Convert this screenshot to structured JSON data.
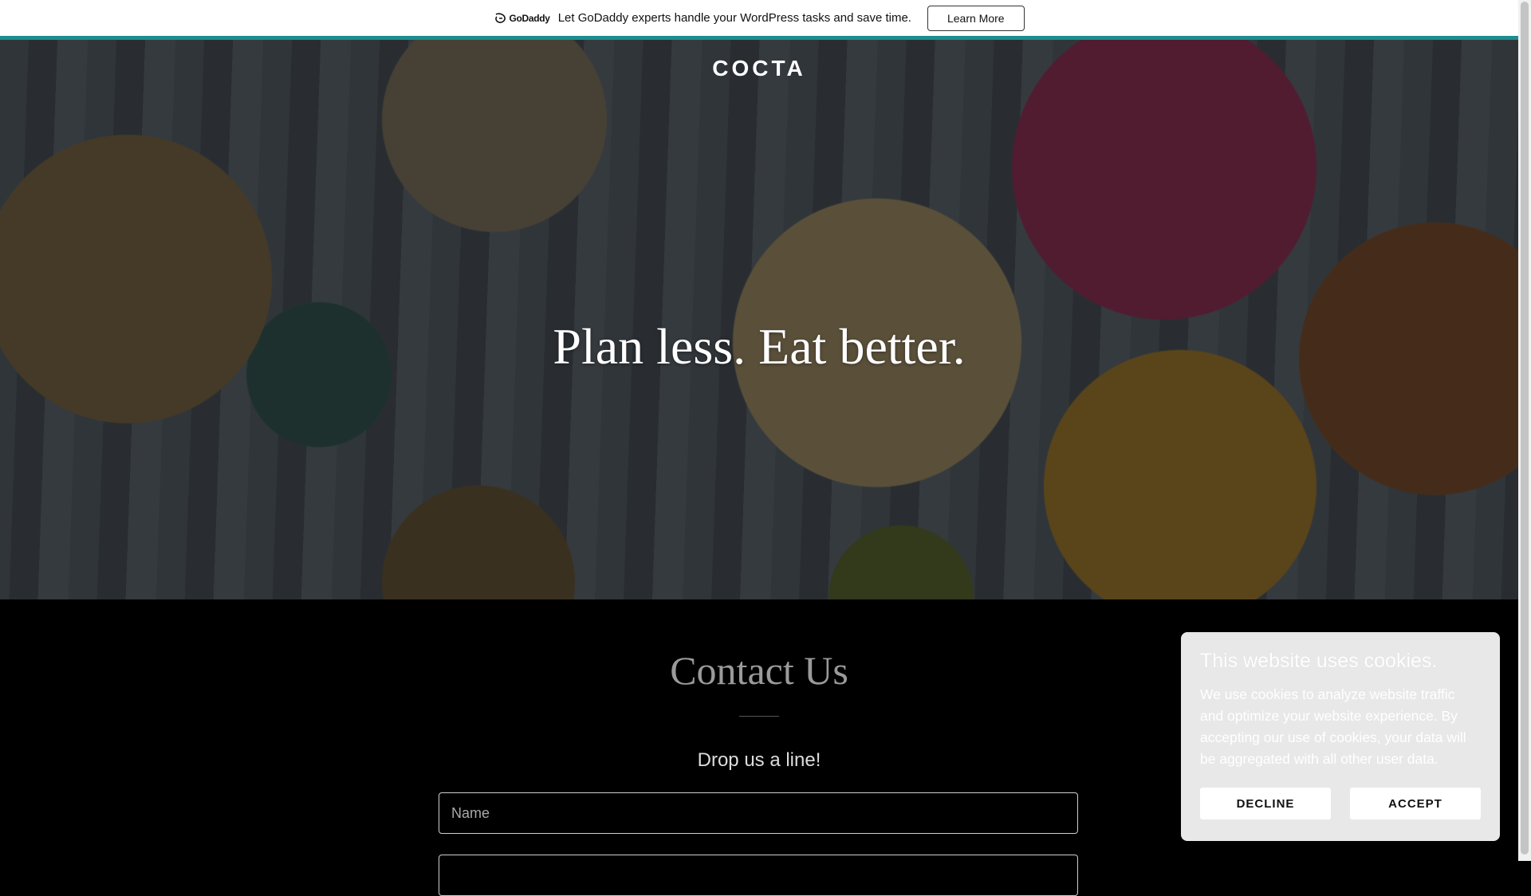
{
  "promo": {
    "logo_text": "GoDaddy",
    "message": "Let GoDaddy experts handle your WordPress tasks and save time.",
    "button_label": "Learn More"
  },
  "hero": {
    "site_title": "COCTA",
    "tagline": "Plan less. Eat better."
  },
  "contact": {
    "title": "Contact Us",
    "subtitle": "Drop us a line!",
    "name_placeholder": "Name",
    "email_placeholder": ""
  },
  "cookie": {
    "title": "This website uses cookies.",
    "text": "We use cookies to analyze website traffic and optimize your website experience. By accepting our use of cookies, your data will be aggregated with all other user data.",
    "decline_label": "DECLINE",
    "accept_label": "ACCEPT"
  },
  "colors": {
    "accent": "#1e8d8f",
    "background": "#000000",
    "cookie_bg": "#e8e8e8"
  }
}
